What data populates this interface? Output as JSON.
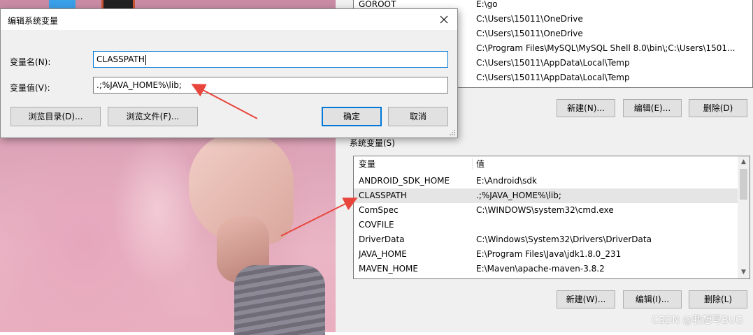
{
  "dialog": {
    "title": "编辑系统变量",
    "name_label": "变量名(N):",
    "name_value": "CLASSPATH",
    "value_label": "变量值(V):",
    "value_value": ".;%JAVA_HOME%\\lib;",
    "browse_dir": "浏览目录(D)...",
    "browse_file": "浏览文件(F)...",
    "ok": "确定",
    "cancel": "取消"
  },
  "user_vars": {
    "rows": [
      {
        "name": "GOROOT",
        "value": "E:\\go"
      },
      {
        "name": "",
        "value": "C:\\Users\\15011\\OneDrive"
      },
      {
        "name": "",
        "value": "C:\\Users\\15011\\OneDrive"
      },
      {
        "name": "",
        "value": "C:\\Program Files\\MySQL\\MySQL Shell 8.0\\bin\\;C:\\Users\\1501..."
      },
      {
        "name": "",
        "value": "C:\\Users\\15011\\AppData\\Local\\Temp"
      },
      {
        "name": "",
        "value": "C:\\Users\\15011\\AppData\\Local\\Temp"
      }
    ],
    "new": "新建(N)...",
    "edit": "编辑(E)...",
    "delete": "删除(D)"
  },
  "system_vars": {
    "label": "系统变量(S)",
    "col_name": "变量",
    "col_value": "值",
    "rows": [
      {
        "name": "ANDROID_SDK_HOME",
        "value": "E:\\Android\\sdk"
      },
      {
        "name": "CLASSPATH",
        "value": ".;%JAVA_HOME%\\lib;"
      },
      {
        "name": "ComSpec",
        "value": "C:\\WINDOWS\\system32\\cmd.exe"
      },
      {
        "name": "COVFILE",
        "value": ""
      },
      {
        "name": "DriverData",
        "value": "C:\\Windows\\System32\\Drivers\\DriverData"
      },
      {
        "name": "JAVA_HOME",
        "value": "E:\\Program Files\\Java\\jdk1.8.0_231"
      },
      {
        "name": "MAVEN_HOME",
        "value": "E:\\Maven\\apache-maven-3.8.2"
      }
    ],
    "selected_index": 1,
    "new": "新建(W)...",
    "edit": "编辑(I)...",
    "delete": "删除(L)"
  },
  "watermark": "CSDN @我想写BUG",
  "colors": {
    "accent": "#0078d7",
    "annotation_arrow": "#e8453c"
  }
}
